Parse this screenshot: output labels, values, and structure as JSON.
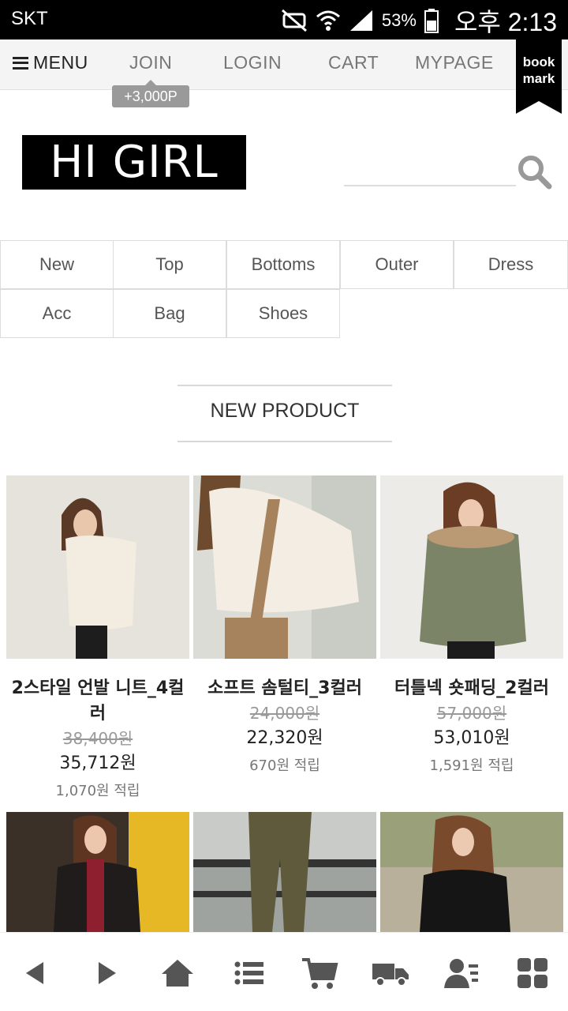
{
  "status_bar": {
    "carrier": "SKT",
    "battery": "53%",
    "time": "오후 2:13",
    "icons": [
      "mute-icon",
      "wifi-icon",
      "signal-icon",
      "battery-icon"
    ]
  },
  "topnav": {
    "menu": "MENU",
    "join": "JOIN",
    "login": "LOGIN",
    "cart": "CART",
    "mypage": "MYPAGE",
    "join_badge": "+3,000P",
    "bookmark_line1": "book",
    "bookmark_line2": "mark"
  },
  "logo": "HI GIRL",
  "search": {
    "value": "",
    "placeholder": ""
  },
  "categories": [
    "New",
    "Top",
    "Bottoms",
    "Outer",
    "Dress",
    "Acc",
    "Bag",
    "Shoes"
  ],
  "section_title": "NEW PRODUCT",
  "products": [
    {
      "name": "2스타일 언발 니트_4컬러",
      "old_price": "38,400원",
      "price": "35,712원",
      "points": "1,070원 적립"
    },
    {
      "name": "소프트 솜털티_3컬러",
      "old_price": "24,000원",
      "price": "22,320원",
      "points": "670원 적립"
    },
    {
      "name": "터틀넥 숏패딩_2컬러",
      "old_price": "57,000원",
      "price": "53,010원",
      "points": "1,591원 적립"
    }
  ],
  "bottom_bar": [
    "back-icon",
    "forward-icon",
    "home-icon",
    "list-icon",
    "cart-icon",
    "delivery-icon",
    "user-icon",
    "grid-icon"
  ],
  "colors": {
    "nav_bg": "#f4f4f4",
    "logo_bg": "#000000",
    "badge_bg": "#9a9a9a",
    "icon_gray": "#555555"
  }
}
